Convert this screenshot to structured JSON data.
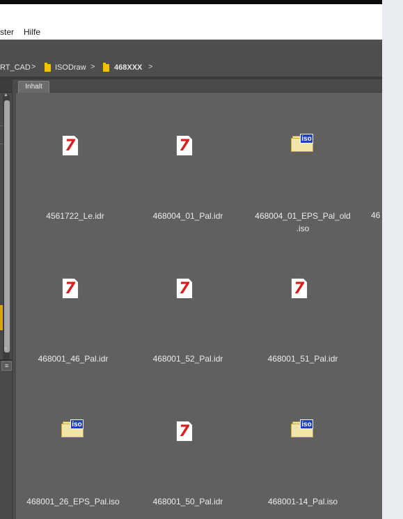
{
  "menu": {
    "item1": "ster",
    "item2": "Hilfe"
  },
  "breadcrumb": {
    "item1": "RT_CAD",
    "item2": "ISODraw",
    "item3": "468XXX",
    "sep": ">"
  },
  "tabs": {
    "active": "Inhalt"
  },
  "files": [
    {
      "name": "4561722_Le.idr",
      "type": "idr"
    },
    {
      "name": "468004_01_Pal.idr",
      "type": "idr"
    },
    {
      "name_line1": "468004_01_EPS_Pal_old",
      "name_line2": ".iso",
      "type": "iso"
    },
    {
      "name": "468001_46_Pal.idr",
      "type": "idr"
    },
    {
      "name": "468001_52_Pal.idr",
      "type": "idr"
    },
    {
      "name": "468001_51_Pal.idr",
      "type": "idr"
    },
    {
      "name": "468001_26_EPS_Pal.iso",
      "type": "iso"
    },
    {
      "name": "468001_50_Pal.idr",
      "type": "idr"
    },
    {
      "name": "468001-14_Pal.iso",
      "type": "iso"
    }
  ],
  "partial_file": "46",
  "icons": {
    "idr_glyph": "7",
    "iso_badge": "iso",
    "menu_glyph": "≡"
  }
}
